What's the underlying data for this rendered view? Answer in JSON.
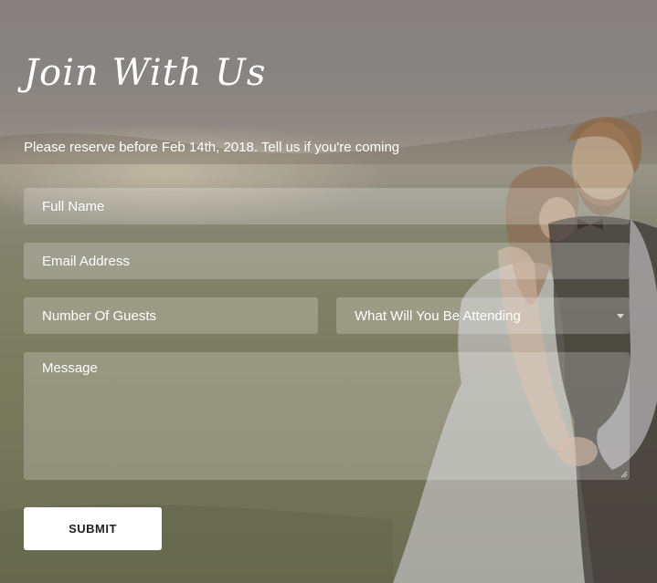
{
  "form": {
    "title": "Join With Us",
    "subtitle": "Please reserve before Feb 14th, 2018. Tell us if you're coming",
    "full_name_placeholder": "Full Name",
    "email_placeholder": "Email Address",
    "guests_placeholder": "Number Of Guests",
    "attending_selected": "What Will You Be Attending",
    "message_placeholder": "Message",
    "submit_label": "SUBMIT"
  },
  "icons": {
    "select_caret": "chevron-down-icon",
    "resize_handle": "resize-grip-icon"
  },
  "colors": {
    "field_background": "rgba(255,255,255,0.22)",
    "text": "#ffffff",
    "button_background": "#ffffff",
    "button_text": "#222222"
  }
}
